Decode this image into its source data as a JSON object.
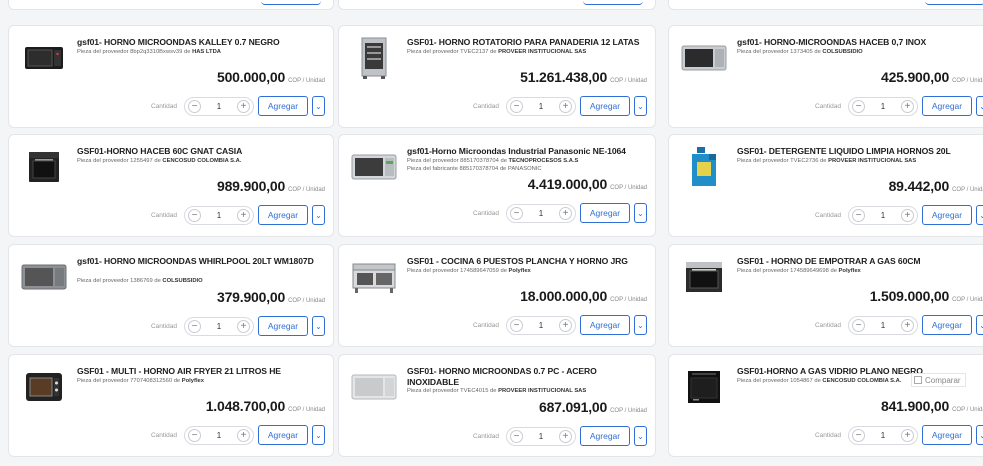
{
  "labels": {
    "quantity": "Cantidad",
    "add": "Agregar",
    "currency_unit": "COP / Unidad",
    "compare": "Comparar"
  },
  "colors": {
    "accent": "#2f6fd6",
    "border": "#e3e5e8",
    "background": "#f4f5f7"
  },
  "products": [
    {
      "title": "gsf01- HORNO MICROONDAS KALLEY 0.7 NEGRO",
      "lines": [
        [
          "Pieza del proveedor 8bp2q3310Bxwsv39 de ",
          "HAS LTDA"
        ]
      ],
      "price": "500.000,00",
      "qty": "1",
      "icon": "microwave-black-icon"
    },
    {
      "title": "GSF01- HORNO ROTATORIO PARA PANADERIA 12 LATAS",
      "lines": [
        [
          "Pieza del proveedor TVEC2137 de ",
          "PROVEER INSTITUCIONAL SAS"
        ]
      ],
      "price": "51.261.438,00",
      "qty": "1",
      "icon": "rotary-oven-icon"
    },
    {
      "title": "gsf01- HORNO-MICROONDAS HACEB 0,7 INOX",
      "lines": [
        [
          "Pieza del proveedor 1373405 de ",
          "COLSUBSIDIO"
        ]
      ],
      "price": "425.900,00",
      "qty": "1",
      "icon": "microwave-steel-icon"
    },
    {
      "title": "GSF01-HORNO HACEB 60C GNAT CASIA",
      "lines": [
        [
          "Pieza del proveedor 1255497 de ",
          "CENCOSUD COLOMBIA S.A."
        ]
      ],
      "price": "989.900,00",
      "qty": "1",
      "icon": "built-in-oven-icon"
    },
    {
      "title": "gsf01-Horno Microondas Industrial Panasonic NE-1064",
      "lines": [
        [
          "Pieza del proveedor 885170378704 de ",
          "TECNOPROCESOS S.A.S"
        ],
        [
          "Pieza del fabricante 885170378704 de PANASONIC",
          ""
        ]
      ],
      "price": "4.419.000,00",
      "qty": "1",
      "icon": "industrial-microwave-icon"
    },
    {
      "title": "GSF01- DETERGENTE LIQUIDO LIMPIA HORNOS 20L",
      "lines": [
        [
          "Pieza del proveedor TVEC2736 de ",
          "PROVEER INSTITUCIONAL SAS"
        ]
      ],
      "price": "89.442,00",
      "qty": "1",
      "icon": "detergent-jug-icon"
    },
    {
      "title": "gsf01- HORNO MICROONDAS WHIRLPOOL 20LT WM1807D",
      "lines": [
        [
          "Pieza del proveedor 1386769 de ",
          "COLSUBSIDIO"
        ]
      ],
      "price": "379.900,00",
      "qty": "1",
      "icon": "microwave-grey-icon"
    },
    {
      "title": "GSF01 - COCINA 6 PUESTOS PLANCHA Y HORNO JRG",
      "lines": [
        [
          "Pieza del proveedor 174589647059 de ",
          "Polyflex"
        ]
      ],
      "price": "18.000.000,00",
      "qty": "1",
      "icon": "kitchen-range-icon"
    },
    {
      "title": "GSF01 - HORNO DE EMPOTRAR A GAS 60CM",
      "lines": [
        [
          "Pieza del proveedor 174589649698 de ",
          "Polyflex"
        ]
      ],
      "price": "1.509.000,00",
      "qty": "1",
      "icon": "gas-oven-icon"
    },
    {
      "title": "GSF01 - MULTI - HORNO AIR FRYER 21 LITROS HE",
      "lines": [
        [
          "Pieza del proveedor 7707408312560 de ",
          "Polyflex"
        ]
      ],
      "price": "1.048.700,00",
      "qty": "1",
      "icon": "air-fryer-oven-icon"
    },
    {
      "title": "GSF01- HORNO MICROONDAS 0.7 PC - ACERO INOXIDABLE",
      "lines": [
        [
          "Pieza del proveedor TVEC4015 de ",
          "PROVEER INSTITUCIONAL SAS"
        ]
      ],
      "price": "687.091,00",
      "qty": "1",
      "icon": "microwave-white-icon"
    },
    {
      "title": "GSF01-HORNO A GAS VIDRIO PLANO NEGRO",
      "lines": [
        [
          "Pieza del proveedor 1054867 de ",
          "CENCOSUD COLOMBIA S.A."
        ]
      ],
      "price": "841.900,00",
      "qty": "1",
      "icon": "glass-gas-oven-icon"
    }
  ]
}
